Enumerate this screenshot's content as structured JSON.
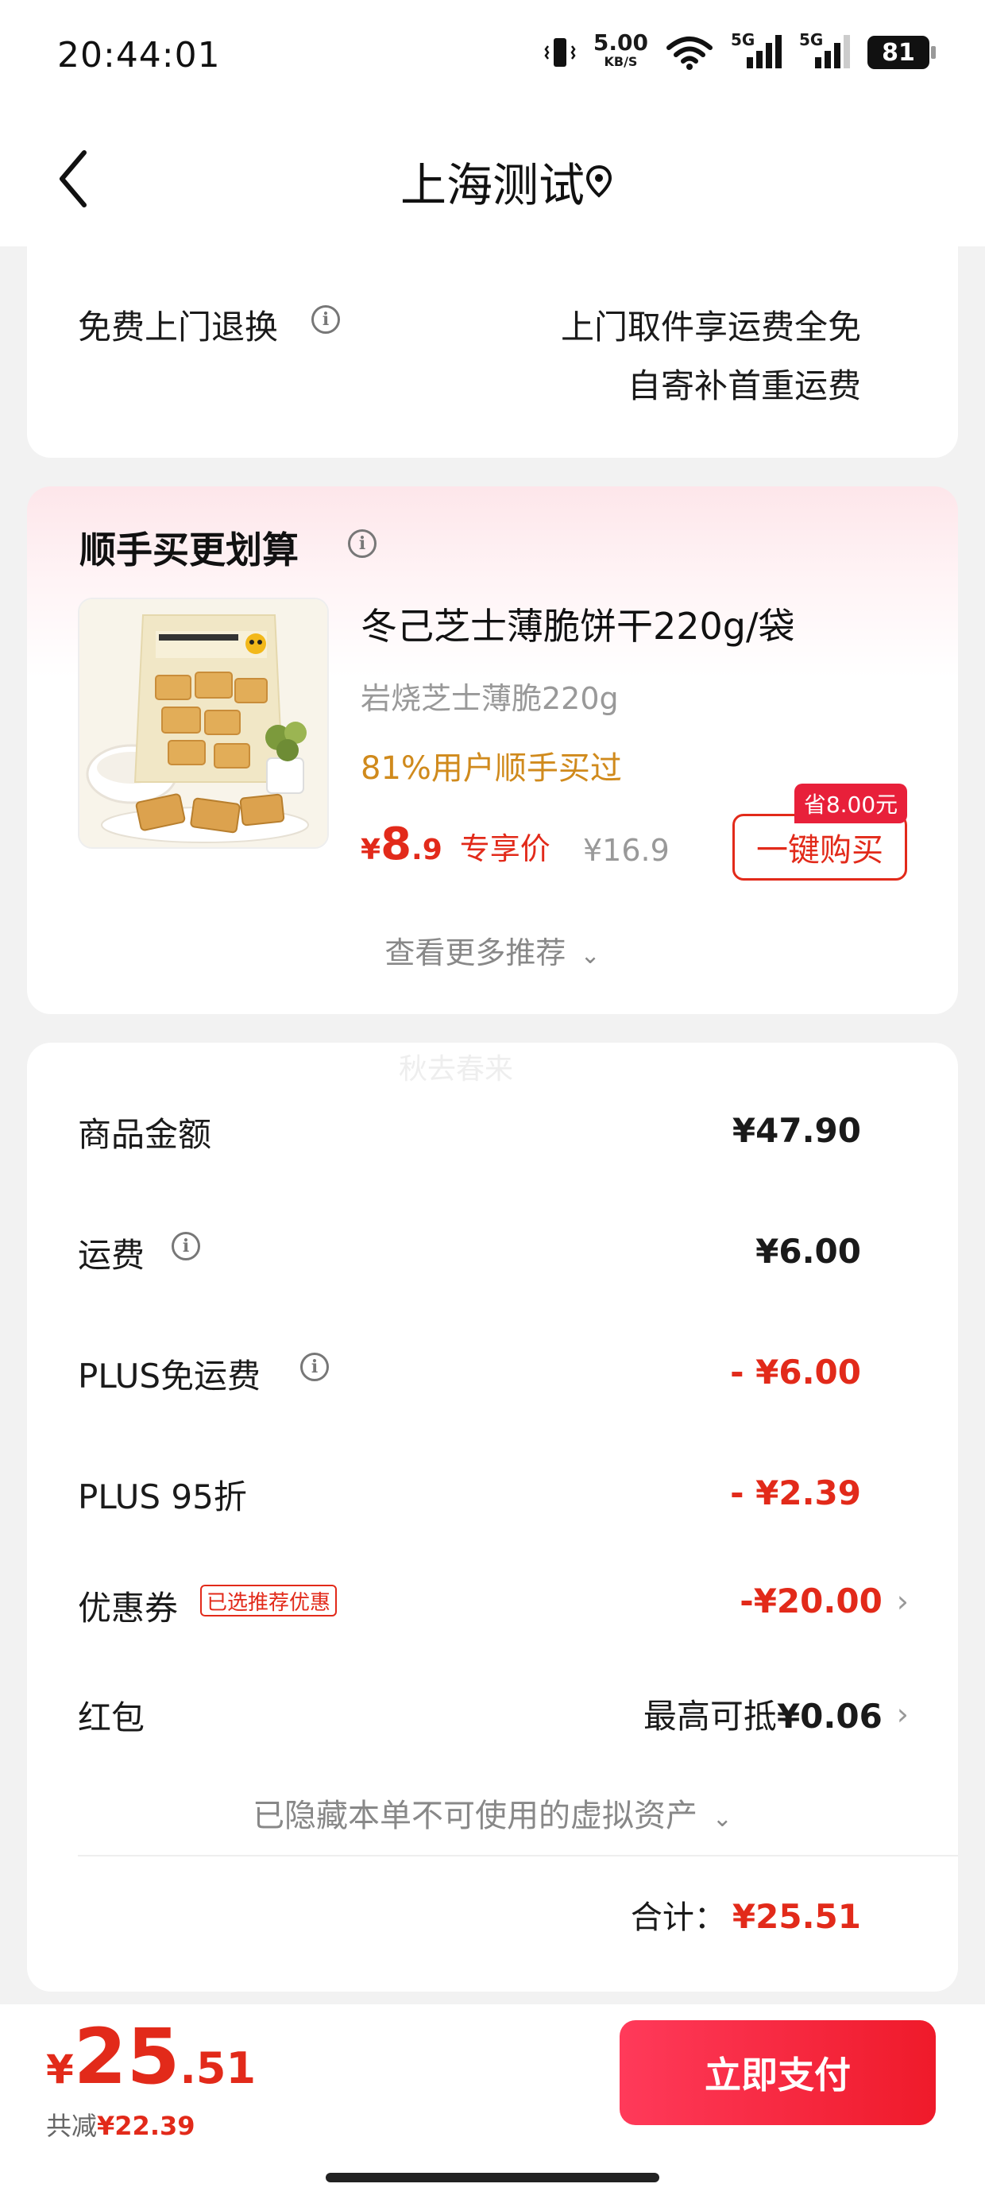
{
  "status_bar": {
    "time": "20:44:01",
    "speed_value": "5.00",
    "speed_unit": "KB/S",
    "signal_1": "5G",
    "signal_2": "5G",
    "battery": "81"
  },
  "nav": {
    "title": "上海测试",
    "back_icon": "chevron-left-icon",
    "location_icon": "location-pin-icon"
  },
  "return_section": {
    "label": "免费上门退换",
    "line1": "上门取件享运费全免",
    "line2": "自寄补首重运费"
  },
  "recommend": {
    "heading": "顺手买更划算",
    "product_name": "冬己芝士薄脆饼干220g/袋",
    "product_spec": "岩烧芝士薄脆220g",
    "bought_rate": "81%用户顺手买过",
    "price_symbol": "¥",
    "price_int": "8",
    "price_dec": ".9",
    "price_label": "专享价",
    "original_price": "¥16.9",
    "save_tag": "省8.00元",
    "buy_button": "一键购买",
    "more": "查看更多推荐"
  },
  "watermark": "秋去春来",
  "summary": {
    "rows": [
      {
        "label": "商品金额",
        "value": "¥47.90"
      },
      {
        "label": "运费",
        "value": "¥6.00"
      },
      {
        "label": "PLUS免运费",
        "value": "- ¥6.00"
      },
      {
        "label": "PLUS 95折",
        "value": "- ¥2.39"
      },
      {
        "label": "优惠券",
        "value": "-¥20.00",
        "tag": "已选推荐优惠"
      },
      {
        "label": "红包",
        "value_prefix": "最高可抵",
        "value": "¥0.06"
      }
    ],
    "hidden_assets": "已隐藏本单不可使用的虚拟资产",
    "total_label": "合计：",
    "total_value": "¥25.51"
  },
  "bottom": {
    "price_symbol": "¥",
    "price_int": "25",
    "price_dec": ".51",
    "saved_label": "共减",
    "saved_value": "¥22.39",
    "pay_button": "立即支付"
  },
  "colors": {
    "accent_red": "#e22a1a",
    "orange": "#d08a1c",
    "pay_gradient_start": "#ff3a5a",
    "pay_gradient_end": "#ef1a2a"
  }
}
